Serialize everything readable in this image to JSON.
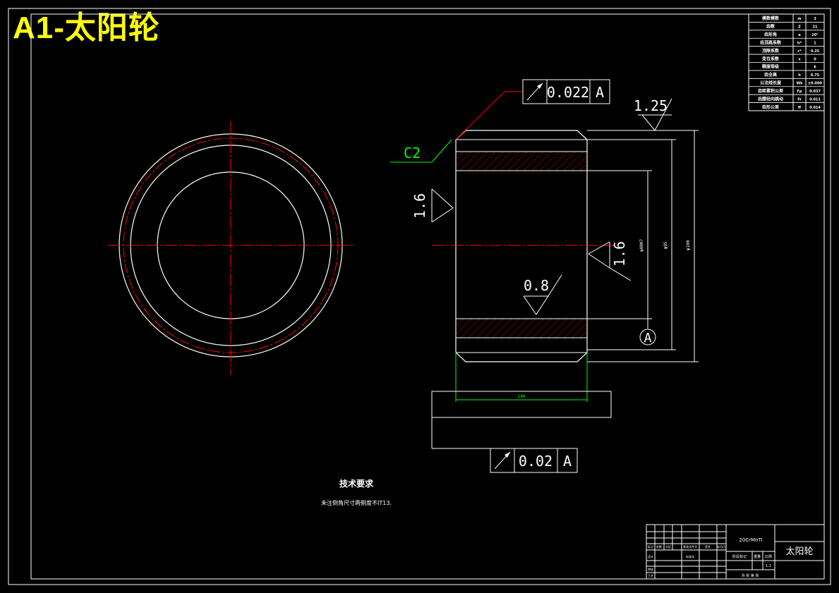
{
  "title": "A1-太阳轮",
  "colors": {
    "background": "#000000",
    "line": "#ffffff",
    "center": "#ff0000",
    "dimension": "#00ff00",
    "title": "#ffff00"
  },
  "geometric_tolerances": [
    {
      "symbol": "circular-runout",
      "value": "0.022",
      "datum": "A"
    },
    {
      "symbol": "circular-runout",
      "value": "0.02",
      "datum": "A"
    }
  ],
  "chamfer": "C2",
  "roughness": {
    "top_right": "1.25",
    "left": "1.6",
    "right": "1.6",
    "bore": "0.8"
  },
  "datum_label": "A",
  "dimensions": {
    "width": "100",
    "d_inner": "φ80H7",
    "d_mid": "φ95",
    "d_outer": "φ100"
  },
  "technical_requirements": {
    "heading": "技术要求",
    "note": "未注倒角尺寸两侧度不IT13."
  },
  "params_table": {
    "rows": [
      [
        "模数模数",
        "m",
        "3"
      ],
      [
        "齿数",
        "Z",
        "31"
      ],
      [
        "齿形角",
        "α",
        "20°"
      ],
      [
        "齿顶高系数",
        "h*",
        "1"
      ],
      [
        "顶隙系数",
        "c*",
        "0.25"
      ],
      [
        "变位系数",
        "x",
        "0"
      ],
      [
        "精度等级",
        "",
        "6"
      ],
      [
        "齿全高",
        "h",
        "6.75"
      ],
      [
        "公法线长度",
        "Wk",
        "±0.000"
      ],
      [
        "齿距累积公差",
        "Fp",
        "0.037"
      ],
      [
        "齿圈径向跳动",
        "Fr",
        "0.011"
      ],
      [
        "齿形公差",
        "ff",
        "0.014"
      ]
    ]
  },
  "title_block": {
    "part_name": "太阳轮",
    "material": "20CrMnTi",
    "labels": [
      "标记",
      "处数",
      "分区",
      "更改文件号",
      "签名",
      "年月日"
    ],
    "labels2": [
      "设计",
      "标准化"
    ],
    "labels3": [
      "阶段标记",
      "重量",
      "比例"
    ],
    "scale": "1:1",
    "sheet": "共 张 第 张",
    "audit": "审核",
    "process": "工艺"
  }
}
